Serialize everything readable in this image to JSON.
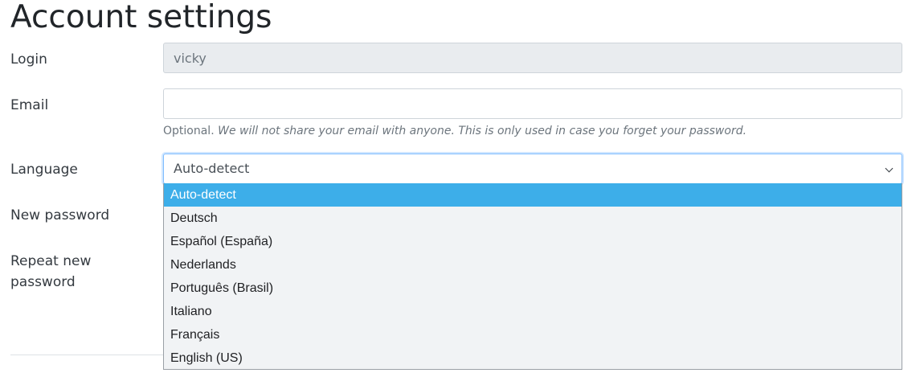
{
  "page": {
    "title": "Account settings"
  },
  "form": {
    "login": {
      "label": "Login",
      "value": "vicky"
    },
    "email": {
      "label": "Email",
      "value": "",
      "help_prefix": "Optional.",
      "help_note": "We will not share your email with anyone. This is only used in case you forget your password."
    },
    "language": {
      "label": "Language",
      "selected": "Auto-detect",
      "options": [
        "Auto-detect",
        "Deutsch",
        "Español (España)",
        "Nederlands",
        "Português (Brasil)",
        "Italiano",
        "Français",
        "English (US)"
      ]
    },
    "new_password": {
      "label": "New password"
    },
    "repeat_password": {
      "label": "Repeat new password"
    }
  },
  "colors": {
    "highlight": "#3daee9",
    "readonly_bg": "#e9ecef",
    "focus_border": "#80bdff"
  },
  "icons": {
    "select_arrow": "chevron-down-icon"
  }
}
